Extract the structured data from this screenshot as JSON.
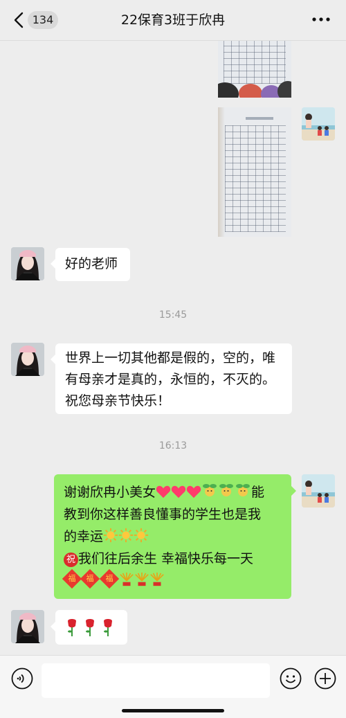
{
  "header": {
    "back_icon": "chevron-left-icon",
    "unread_count": "134",
    "title": "22保育3班于欣冉",
    "more_icon": "more-dots-icon"
  },
  "messages": {
    "photo1": {
      "sender": "me",
      "type": "image"
    },
    "photo2": {
      "sender": "me",
      "type": "image"
    },
    "msg1": {
      "sender": "other",
      "text": "好的老师"
    },
    "time1": "15:45",
    "msg2": {
      "sender": "other",
      "line1": "世界上一切其他都是假的，空的，唯",
      "line2": "有母亲才是真的，永恒的，不灭的。",
      "line3": "祝您母亲节快乐！"
    },
    "time2": "16:13",
    "msg3": {
      "sender": "me",
      "line1_text": "谢谢欣冉小美女",
      "line1_end": "能",
      "line2": "教到你这样善良懂事的学生也是我",
      "line3_text": "的幸运",
      "line4_badge": "祝",
      "line4_text": "我们往后余生 幸福快乐每一天",
      "line5_badge": "福"
    },
    "msg4": {
      "sender": "other",
      "emoji": "rose-emoji"
    }
  },
  "colors": {
    "bg": "#ededed",
    "self_bubble": "#95ec69",
    "other_bubble": "#ffffff",
    "timestamp": "#9a9a9a"
  },
  "bottom_bar": {
    "voice_icon": "voice-icon",
    "emoji_icon": "emoji-face-icon",
    "plus_icon": "plus-icon"
  }
}
